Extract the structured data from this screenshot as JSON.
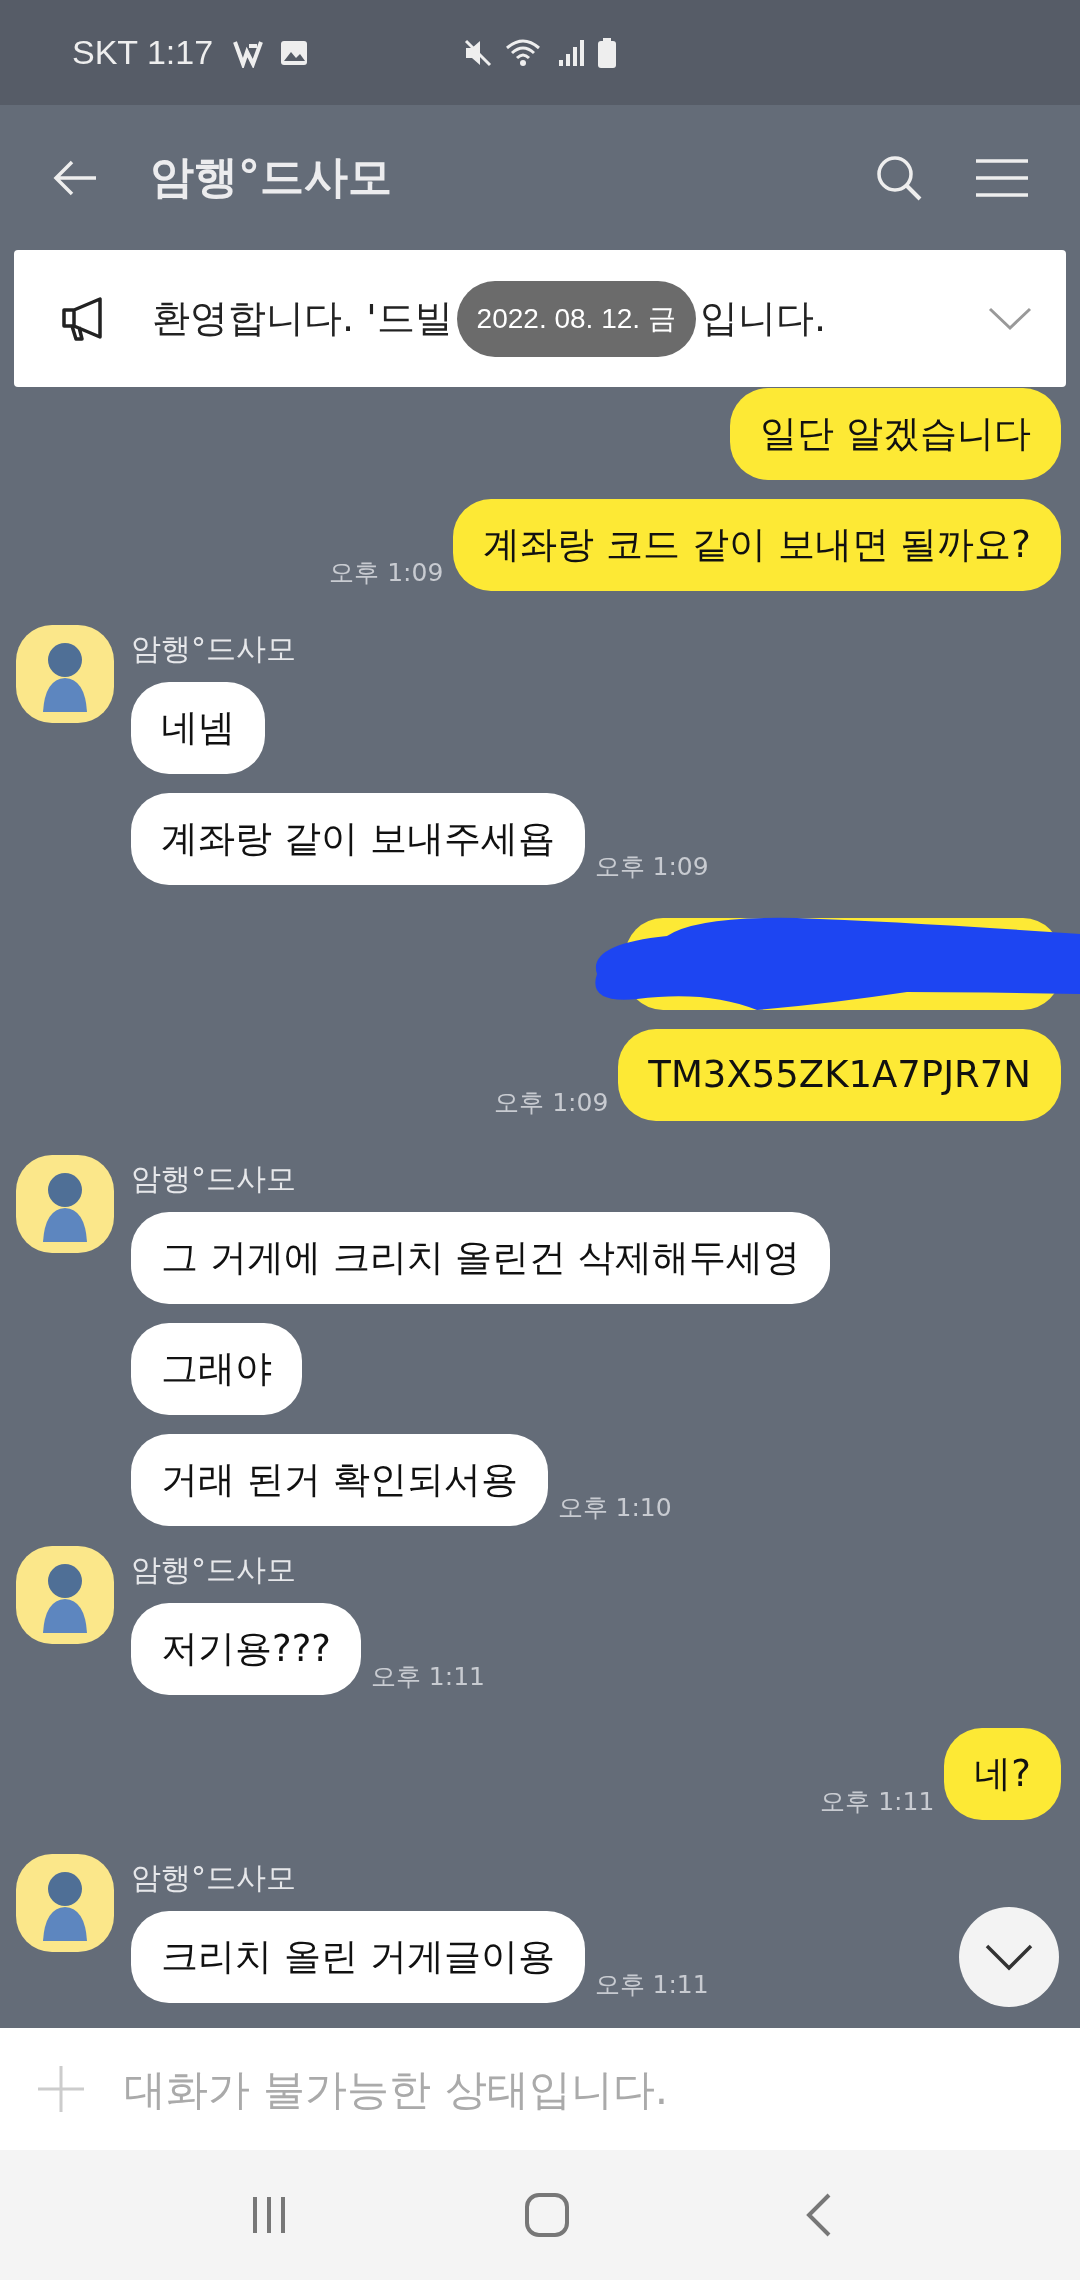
{
  "status_bar": {
    "carrier_time": "SKT 1:17"
  },
  "header": {
    "title": "암행°드사모"
  },
  "notice": {
    "text_before": "환영합니다. '드빌",
    "date": "2022. 08. 12. 금",
    "text_after": "입니다."
  },
  "messages": [
    {
      "kind": "sent",
      "text": "일단 알겠습니다"
    },
    {
      "kind": "sent",
      "text": "계좌랑 코드 같이 보내면 될까요?",
      "time": "오후 1:09"
    },
    {
      "kind": "received",
      "sender": "암행°드사모",
      "bubbles": [
        {
          "text": "네넴"
        },
        {
          "text": "계좌랑 같이 보내주세욥",
          "time": "오후 1:09"
        }
      ]
    },
    {
      "kind": "redacted"
    },
    {
      "kind": "sent",
      "text": "TM3X55ZK1A7PJR7N",
      "time": "오후 1:09"
    },
    {
      "kind": "received",
      "sender": "암행°드사모",
      "bubbles": [
        {
          "text": "그 거게에 크리치 올린건 삭제해두세영"
        },
        {
          "text": "그래야"
        },
        {
          "text": "거래 된거 확인되서용",
          "time": "오후 1:10"
        }
      ]
    },
    {
      "kind": "received",
      "sender": "암행°드사모",
      "bubbles": [
        {
          "text": "저기용???",
          "time": "오후 1:11"
        }
      ]
    },
    {
      "kind": "sent",
      "text": "네?",
      "time": "오후 1:11"
    },
    {
      "kind": "received",
      "sender": "암행°드사모",
      "bubbles": [
        {
          "text": "크리치 올린 거게글이용",
          "time": "오후 1:11"
        }
      ]
    }
  ],
  "input": {
    "placeholder": "대화가 불가능한 상태입니다."
  }
}
